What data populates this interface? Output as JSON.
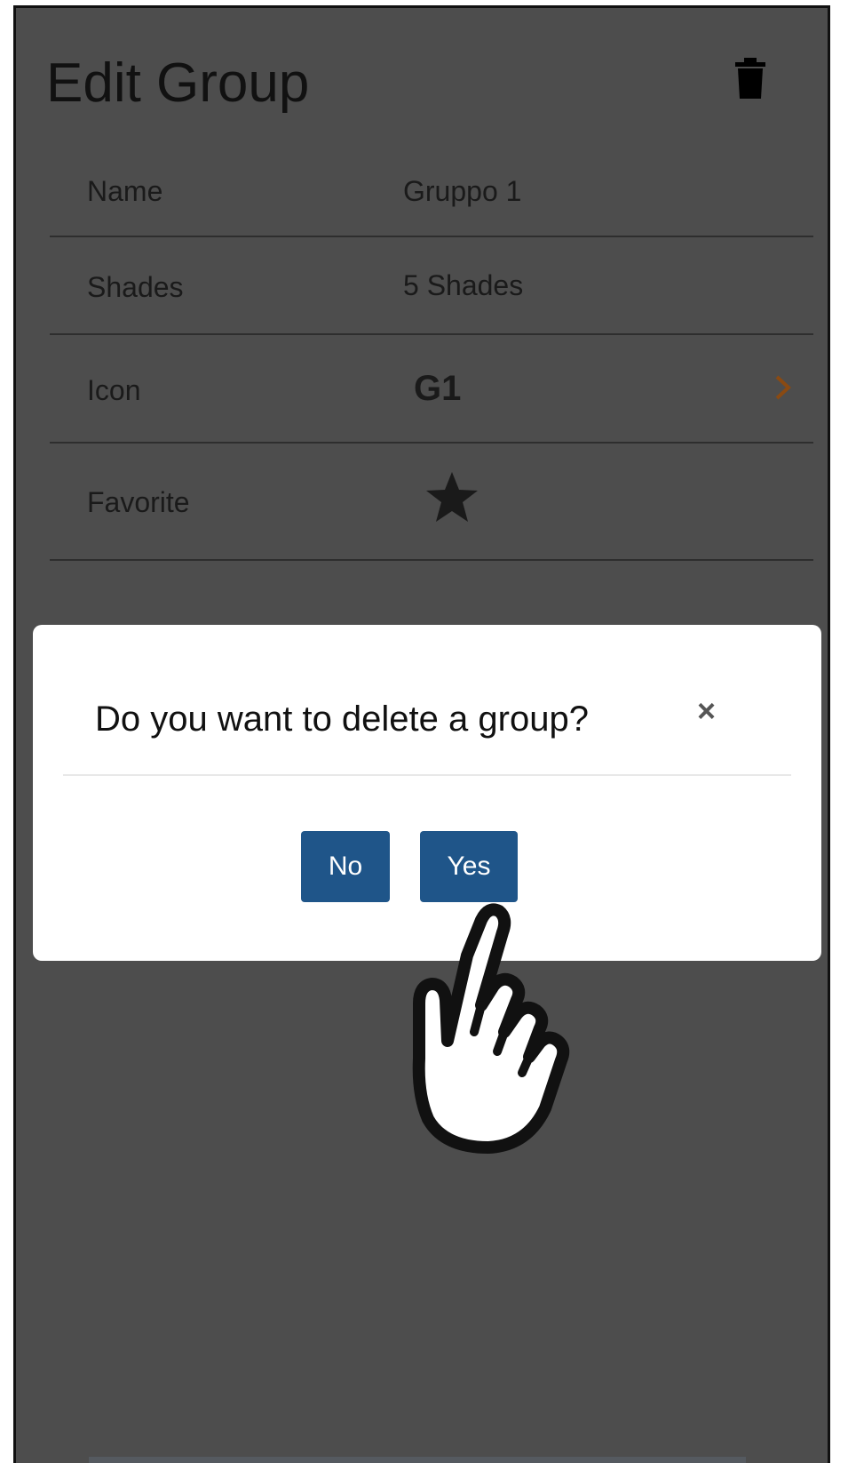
{
  "header": {
    "title": "Edit Group",
    "delete_icon": "trash-icon"
  },
  "fields": {
    "name": {
      "label": "Name",
      "value": "Gruppo 1"
    },
    "shades": {
      "label": "Shades",
      "value": "5 Shades"
    },
    "icon": {
      "label": "Icon",
      "value": "G1",
      "chevron_icon": "chevron-right-icon"
    },
    "favorite": {
      "label": "Favorite",
      "icon": "star-icon"
    }
  },
  "dialog": {
    "title": "Do you want to delete a group?",
    "close_label": "×",
    "no_label": "No",
    "yes_label": "Yes"
  },
  "overlay": {
    "pointer_icon": "hand-pointer-icon"
  },
  "colors": {
    "background": "#4d4d4d",
    "button": "#1f5589",
    "accent_chevron": "#8a4a12"
  }
}
